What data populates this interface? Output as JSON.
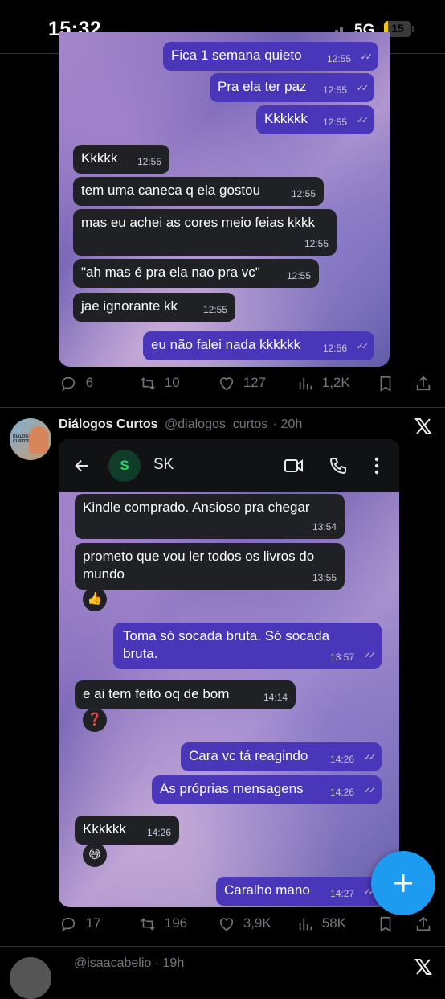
{
  "status": {
    "time": "15:32",
    "network": "5G",
    "battery": "15",
    "battery_level": 0.15
  },
  "post1": {
    "chat": [
      {
        "side": "out",
        "text": "Fica 1 semana quieto",
        "time": "12:55"
      },
      {
        "side": "out",
        "text": "Pra ela ter paz",
        "time": "12:55"
      },
      {
        "side": "out",
        "text": "Kkkkkk",
        "time": "12:55"
      },
      {
        "side": "in",
        "text": "Kkkkk",
        "time": "12:55"
      },
      {
        "side": "in",
        "text": "tem uma caneca q ela gostou",
        "time": "12:55"
      },
      {
        "side": "in",
        "text": "mas eu achei as cores meio feias kkkk",
        "time": "12:55"
      },
      {
        "side": "in",
        "text": "\"ah mas é pra ela nao pra vc\"",
        "time": "12:55"
      },
      {
        "side": "in",
        "text": "jae ignorante kk",
        "time": "12:55"
      },
      {
        "side": "out",
        "text": "eu não falei nada kkkkkk",
        "time": "12:56"
      }
    ],
    "actions": {
      "replies": "6",
      "reposts": "10",
      "likes": "127",
      "views": "1,2K"
    }
  },
  "post2": {
    "author": {
      "name": "Diálogos Curtos",
      "handle": "@dialogos_curtos",
      "time": "· 20h",
      "avatar_text": "DIÁLOGOS CURTOS"
    },
    "chat_header": {
      "avatar_letter": "S",
      "contact": "SK"
    },
    "chat": [
      {
        "side": "in",
        "text": "Kindle comprado. Ansioso pra chegar",
        "time": "13:54"
      },
      {
        "side": "in",
        "text": "prometo que vou ler todos os livros do mundo",
        "time": "13:55",
        "reaction": "👍"
      },
      {
        "side": "out",
        "text": "Toma só socada bruta. Só socada bruta.",
        "time": "13:57"
      },
      {
        "side": "in",
        "text": "e ai tem feito oq de bom",
        "time": "14:14",
        "reaction": "❓"
      },
      {
        "side": "out",
        "text": "Cara vc tá reagindo",
        "time": "14:26"
      },
      {
        "side": "out",
        "text": "As próprias mensagens",
        "time": "14:26"
      },
      {
        "side": "in",
        "text": "Kkkkkk",
        "time": "14:26",
        "reaction": "😅"
      },
      {
        "side": "out",
        "text": "Caralho mano",
        "time": "14:27"
      }
    ],
    "actions": {
      "replies": "17",
      "reposts": "196",
      "likes": "3,9K",
      "views": "58K"
    }
  },
  "post3": {
    "author_partial": "@isaacabelio · 19h"
  },
  "colors": {
    "accent": "#1d9bf0",
    "outgoing": "#4a36b8",
    "incoming": "#1f2124"
  }
}
